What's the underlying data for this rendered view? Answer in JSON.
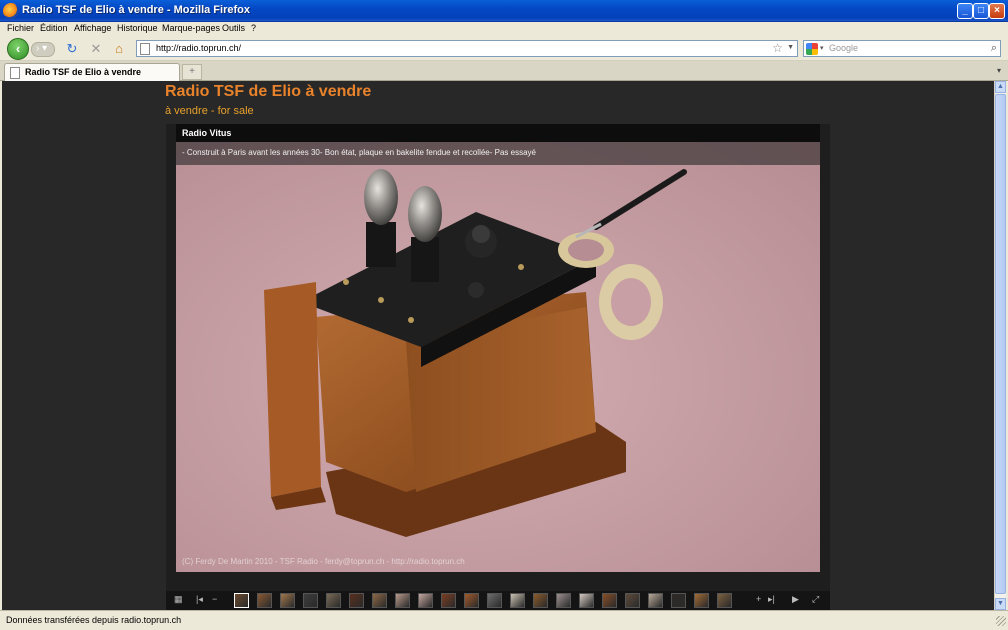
{
  "window": {
    "title": "Radio TSF de Elio à vendre - Mozilla Firefox"
  },
  "menu": [
    "Fichier",
    "Édition",
    "Affichage",
    "Historique",
    "Marque-pages",
    "Outils",
    "?"
  ],
  "nav": {
    "url": "http://radio.toprun.ch/",
    "search_placeholder": "Google"
  },
  "tab": {
    "title": "Radio TSF de Elio à vendre"
  },
  "page": {
    "title": "Radio TSF de Elio à vendre",
    "subtitle": "à vendre - for sale"
  },
  "gallery": {
    "photo_title": "Radio Vitus",
    "description": "- Construit à Paris avant les années 30- Bon état, plaque en bakelite fendue et recollée- Pas essayé",
    "watermark": "(C) Ferdy De Martin 2010 - TSF Radio - ferdy@toprun.ch - http://radio.toprun.ch",
    "thumbnail_count": 22,
    "active_thumbnail": 1
  },
  "status": {
    "text": "Données transférées depuis radio.toprun.ch"
  },
  "colors": {
    "page_bg": "#282828",
    "title": "#e8822b",
    "subtitle": "#e8a12b",
    "carpet": "#c9a0a5"
  }
}
